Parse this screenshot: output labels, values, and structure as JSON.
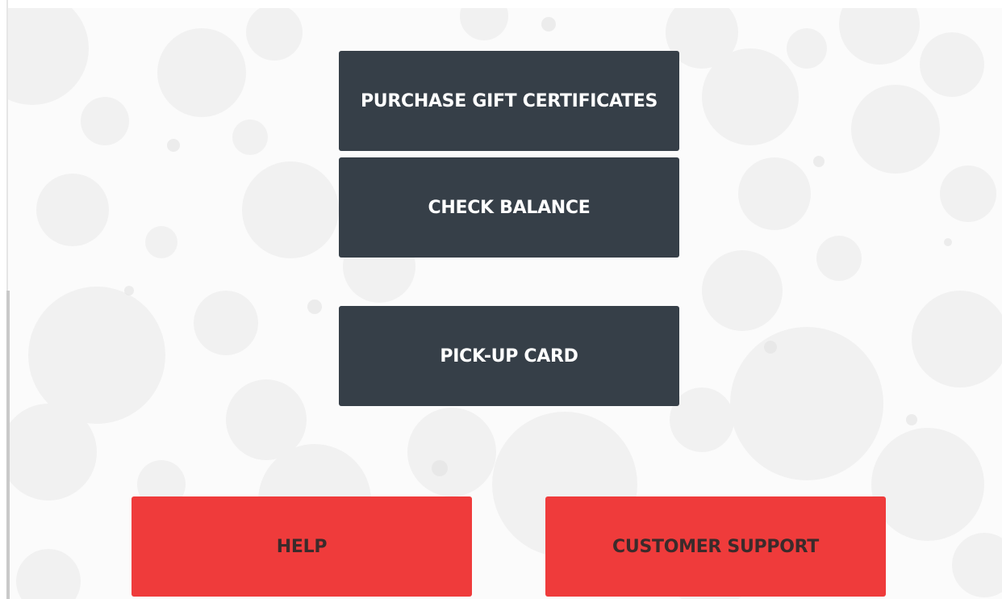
{
  "main_menu": {
    "purchase_label": "PURCHASE GIFT CERTIFICATES",
    "balance_label": "CHECK BALANCE",
    "pickup_label": "PICK-UP CARD"
  },
  "footer": {
    "help_label": "HELP",
    "support_label": "CUSTOMER SUPPORT"
  },
  "colors": {
    "primary_button": "#363f48",
    "primary_text": "#ffffff",
    "accent_button": "#ef3b3b",
    "accent_text": "#3b2b2b",
    "background": "#fbfbfb",
    "bokeh": "#eaeaea"
  }
}
